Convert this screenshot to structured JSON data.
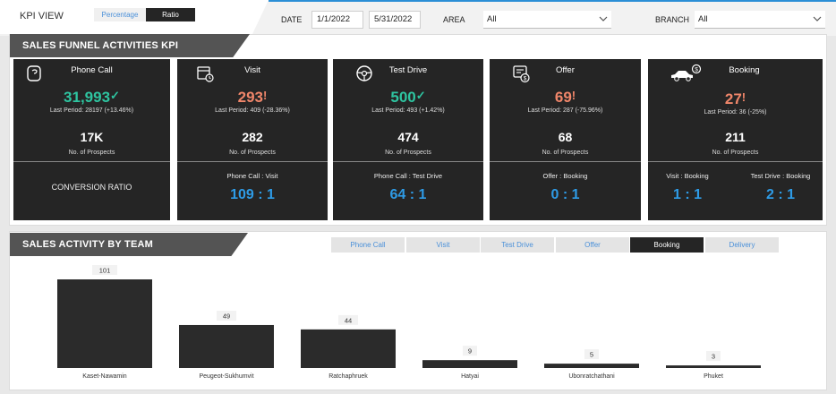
{
  "header": {
    "title": "KPI VIEW",
    "toggle": {
      "percentage": "Percentage",
      "ratio": "Ratio",
      "selected": "Ratio"
    },
    "date_label": "DATE",
    "date_start": "1/1/2022",
    "date_end": "5/31/2022",
    "area_label": "AREA",
    "area_value": "All",
    "branch_label": "BRANCH",
    "branch_value": "All"
  },
  "funnel": {
    "title": "SALES FUNNEL ACTIVITIES KPI",
    "prospects_label": "No. of Prospects",
    "cards": [
      {
        "title": "Phone Call",
        "icon": "phone-chat-icon",
        "value": "31,993",
        "status": "good",
        "last_period": "Last Period: 28197 (+13.46%)",
        "prospects": "17K",
        "ratio_label": "CONVERSION RATIO"
      },
      {
        "title": "Visit",
        "icon": "calendar-clock-icon",
        "value": "293",
        "status": "bad",
        "last_period": "Last Period: 409 (-28.36%)",
        "prospects": "282",
        "ratio_name": "Phone Call : Visit",
        "ratio_value": "109 : 1"
      },
      {
        "title": "Test Drive",
        "icon": "steering-wheel-icon",
        "value": "500",
        "status": "good",
        "last_period": "Last Period: 493 (+1.42%)",
        "prospects": "474",
        "ratio_name": "Phone Call : Test Drive",
        "ratio_value": "64 : 1"
      },
      {
        "title": "Offer",
        "icon": "invoice-dollar-icon",
        "value": "69",
        "status": "bad",
        "last_period": "Last Period: 287 (-75.96%)",
        "prospects": "68",
        "ratio_name": "Offer : Booking",
        "ratio_value": "0 : 1"
      },
      {
        "title": "Booking",
        "icon": "car-dollar-icon",
        "value": "27",
        "status": "bad",
        "last_period": "Last Period: 36 (-25%)",
        "prospects": "211",
        "ratio_name": "Visit : Booking",
        "ratio_value": "1 : 1",
        "ratio_name_2": "Test Drive : Booking",
        "ratio_value_2": "2 : 1"
      }
    ]
  },
  "team": {
    "title": "SALES ACTIVITY BY  TEAM",
    "tabs": [
      "Phone Call",
      "Visit",
      "Test Drive",
      "Offer",
      "Booking",
      "Delivery"
    ],
    "active_tab": "Booking"
  },
  "colors": {
    "card_bg": "#252525",
    "good": "#2ec4a0",
    "bad": "#f0866a",
    "ratio": "#2e9be6",
    "accent": "#2b8fd6"
  },
  "chart_data": {
    "type": "bar",
    "categories": [
      "Kaset-Nawamin",
      "Peugeot-Sukhumvit",
      "Ratchaphruek",
      "Hatyai",
      "Ubonratchathani",
      "Phuket"
    ],
    "values": [
      101,
      49,
      44,
      9,
      5,
      3
    ],
    "ylim": [
      0,
      101
    ],
    "grid": false
  }
}
